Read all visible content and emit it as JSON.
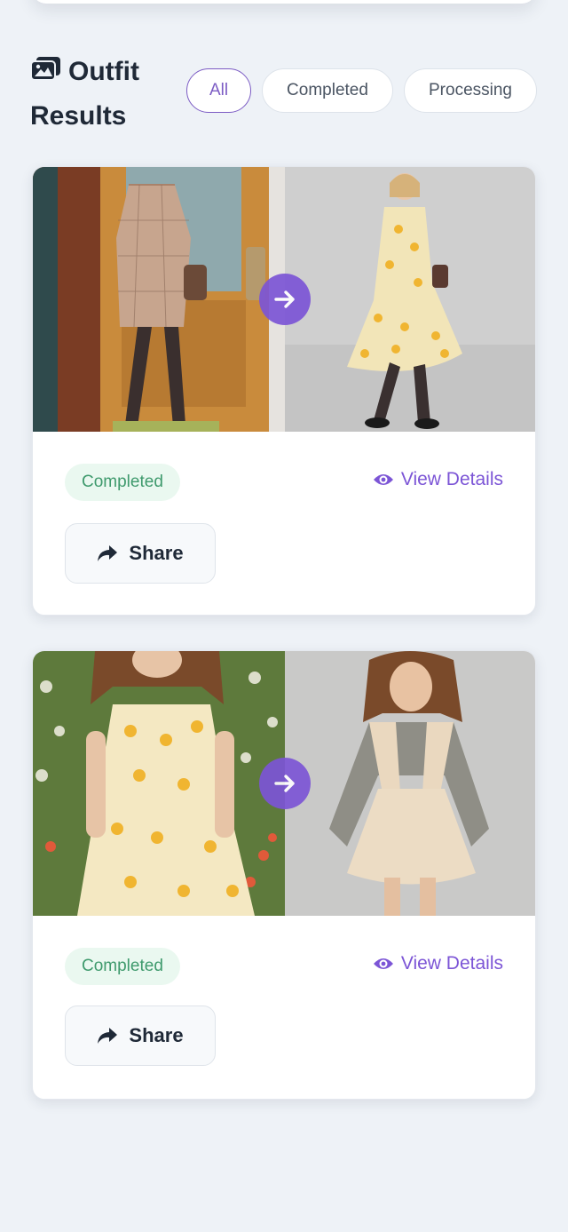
{
  "header": {
    "title": "Outfit Results",
    "icon": "gallery-icon"
  },
  "filters": [
    {
      "label": "All",
      "active": true
    },
    {
      "label": "Completed",
      "active": false
    },
    {
      "label": "Processing",
      "active": false
    }
  ],
  "results": [
    {
      "original_image": "woman-in-plaid-coat-by-door",
      "result_image": "woman-in-yellow-floral-dress",
      "status": "Completed",
      "view_details_label": "View Details",
      "share_label": "Share"
    },
    {
      "original_image": "woman-in-yellow-floral-dress-garden",
      "result_image": "woman-in-cream-pinafore-dress",
      "status": "Completed",
      "view_details_label": "View Details",
      "share_label": "Share"
    }
  ],
  "colors": {
    "accent": "#7c55d6",
    "status_bg": "#eaf8f0",
    "status_text": "#3f9a6d",
    "page_bg": "#eef2f7"
  }
}
